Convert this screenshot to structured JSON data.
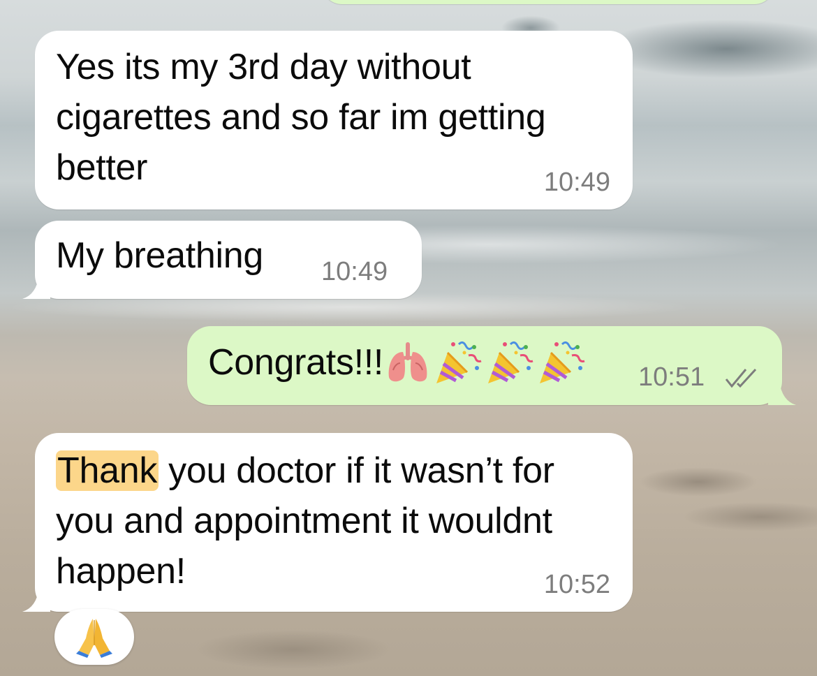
{
  "messages": [
    {
      "direction": "incoming",
      "text": "Yes its my 3rd day without\ncigarettes and so far im getting\nbetter",
      "time": "10:49"
    },
    {
      "direction": "incoming",
      "text": "My breathing",
      "time": "10:49"
    },
    {
      "direction": "outgoing",
      "text": "Congrats!!!",
      "emojis": [
        "lungs-emoji",
        "party-popper-emoji",
        "party-popper-emoji",
        "party-popper-emoji"
      ],
      "time": "10:51",
      "status": "read-double-check"
    },
    {
      "direction": "incoming",
      "highlight": "Thank",
      "text_rest": " you doctor if it wasn’t for\nyou and appointment it wouldnt\nhappen!",
      "time": "10:52",
      "reaction": "folded-hands-emoji"
    }
  ],
  "colors": {
    "incoming_bubble": "#ffffff",
    "outgoing_bubble": "#dcf8c6",
    "timestamp": "#7d7d7d",
    "read_check": "#7d7d7d",
    "search_highlight": "#fcd68a"
  }
}
